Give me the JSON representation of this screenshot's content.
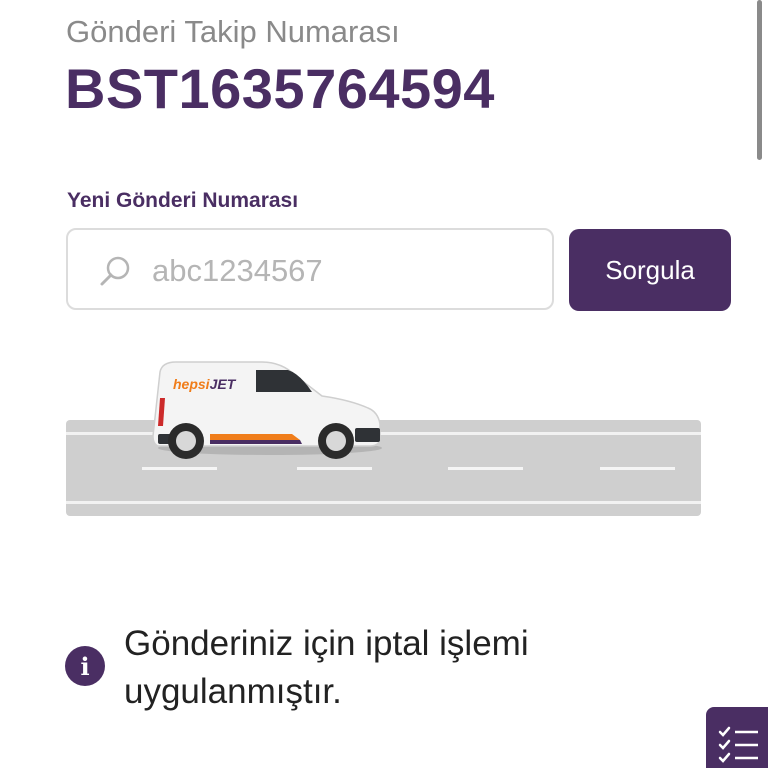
{
  "tracking": {
    "label": "Gönderi Takip Numarası",
    "number": "BST1635764594"
  },
  "search": {
    "label": "Yeni Gönderi Numarası",
    "placeholder": "abc1234567",
    "value": "",
    "button_label": "Sorgula"
  },
  "illustration": {
    "van_brand": "hepsiJET",
    "van_brand_parts": [
      "hepsi",
      "JET"
    ]
  },
  "notice": {
    "icon": "info-icon",
    "message": "Gönderiniz için iptal işlemi uygulanmıştır."
  },
  "colors": {
    "brand_purple": "#4a2e63",
    "brand_orange": "#f07d1a",
    "road_gray": "#cfcfcf"
  },
  "floating_button": {
    "icon": "checklist-icon"
  }
}
